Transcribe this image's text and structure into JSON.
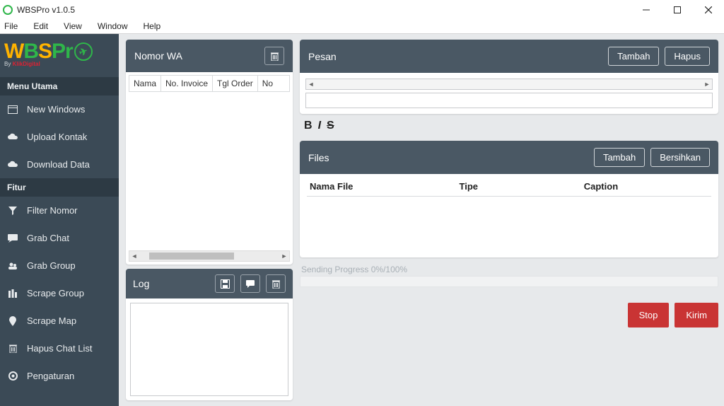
{
  "window": {
    "title": "WBSPro v1.0.5"
  },
  "menubar": [
    "File",
    "Edit",
    "View",
    "Window",
    "Help"
  ],
  "sidebar": {
    "logo_sub_prefix": "By ",
    "logo_sub_brand": "KlikDigital",
    "section_main": "Menu Utama",
    "items_main": [
      {
        "label": "New Windows"
      },
      {
        "label": "Upload Kontak"
      },
      {
        "label": "Download Data"
      }
    ],
    "section_fitur": "Fitur",
    "items_fitur": [
      {
        "label": "Filter Nomor"
      },
      {
        "label": "Grab Chat"
      },
      {
        "label": "Grab Group"
      },
      {
        "label": "Scrape Group"
      },
      {
        "label": "Scrape Map"
      },
      {
        "label": "Hapus Chat List"
      },
      {
        "label": "Pengaturan"
      }
    ]
  },
  "nomor_wa": {
    "title": "Nomor WA",
    "columns": [
      "Nama",
      "No. Invoice",
      "Tgl Order",
      "No"
    ]
  },
  "log": {
    "title": "Log",
    "text": ""
  },
  "pesan": {
    "title": "Pesan",
    "btn_add": "Tambah",
    "btn_del": "Hapus",
    "input_value": ""
  },
  "format": {
    "bold": "B",
    "italic": "I",
    "strike": "S"
  },
  "files": {
    "title": "Files",
    "btn_add": "Tambah",
    "btn_clear": "Bersihkan",
    "col_name": "Nama File",
    "col_type": "Tipe",
    "col_caption": "Caption"
  },
  "progress": {
    "text": "Sending Progress 0%/100%"
  },
  "actions": {
    "stop": "Stop",
    "send": "Kirim"
  }
}
